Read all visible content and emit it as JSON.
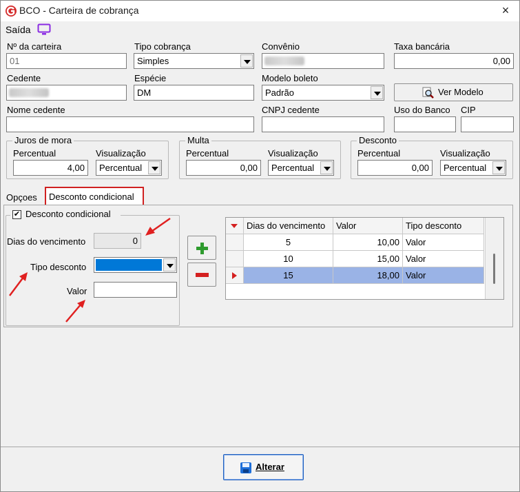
{
  "window": {
    "title": "BCO - Carteira de cobrança",
    "close_icon": "×"
  },
  "toolbar": {
    "exit_label": "Saída"
  },
  "fields": {
    "num_carteira": {
      "label": "Nº da carteira",
      "value": "01"
    },
    "tipo_cobranca": {
      "label": "Tipo cobrança",
      "value": "Simples"
    },
    "convenio": {
      "label": "Convênio"
    },
    "taxa_bancaria": {
      "label": "Taxa bancária",
      "value": "0,00"
    },
    "cedente": {
      "label": "Cedente"
    },
    "especie": {
      "label": "Espécie",
      "value": "DM"
    },
    "modelo_boleto": {
      "label": "Modelo boleto",
      "value": "Padrão"
    },
    "ver_modelo": {
      "label": "Ver Modelo"
    },
    "nome_cedente": {
      "label": "Nome cedente",
      "value": ""
    },
    "cnpj_cedente": {
      "label": "CNPJ cedente",
      "value": ""
    },
    "uso_banco": {
      "label": "Uso do Banco",
      "value": ""
    },
    "cip": {
      "label": "CIP",
      "value": ""
    }
  },
  "groups": {
    "juros": {
      "title": "Juros de mora",
      "percentual_label": "Percentual",
      "percentual_value": "4,00",
      "visualizacao_label": "Visualização",
      "visualizacao_value": "Percentual"
    },
    "multa": {
      "title": "Multa",
      "percentual_label": "Percentual",
      "percentual_value": "0,00",
      "visualizacao_label": "Visualização",
      "visualizacao_value": "Percentual"
    },
    "desconto": {
      "title": "Desconto",
      "percentual_label": "Percentual",
      "percentual_value": "0,00",
      "visualizacao_label": "Visualização",
      "visualizacao_value": "Percentual"
    }
  },
  "tabs": [
    {
      "label": "Opçoes",
      "active": false
    },
    {
      "label": "Desconto condicional",
      "active": true
    }
  ],
  "desconto_condicional": {
    "checkbox_label": "Desconto condicional",
    "checked": true,
    "dias_label": "Dias do vencimento",
    "dias_value": "0",
    "tipo_label": "Tipo desconto",
    "tipo_value": "",
    "valor_label": "Valor",
    "valor_value": ""
  },
  "grid": {
    "columns": [
      "Dias do vencimento",
      "Valor",
      "Tipo desconto"
    ],
    "rows": [
      {
        "dias": "5",
        "valor": "10,00",
        "tipo": "Valor",
        "selected": false
      },
      {
        "dias": "10",
        "valor": "15,00",
        "tipo": "Valor",
        "selected": false
      },
      {
        "dias": "15",
        "valor": "18,00",
        "tipo": "Valor",
        "selected": true
      }
    ]
  },
  "footer": {
    "alterar_label": "Alterar"
  },
  "colors": {
    "highlight": "#9ab3e6",
    "selected_combo": "#0078d7",
    "annotation": "#e02020",
    "tab_border": "#d02020"
  }
}
